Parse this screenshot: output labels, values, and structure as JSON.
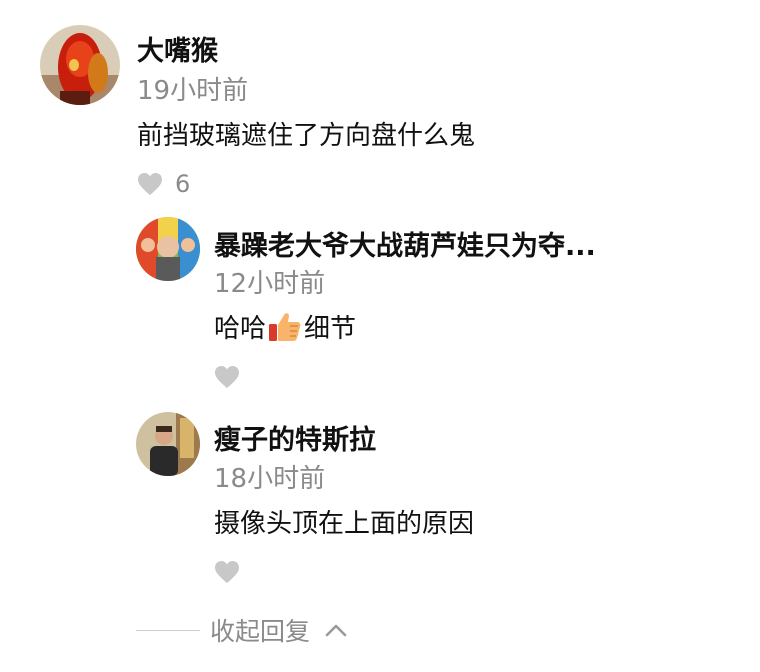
{
  "comment": {
    "author": "大嘴猴",
    "time": "19小时前",
    "text": "前挡玻璃遮住了方向盘什么鬼",
    "likes": "6"
  },
  "replies": [
    {
      "author": "暴躁老大爷大战葫芦娃只为夺...",
      "time": "12小时前",
      "text_before": "哈哈",
      "emoji": "thumbs-up-icon",
      "text_after": "细节"
    },
    {
      "author": "瘦子的特斯拉",
      "time": "18小时前",
      "text": "摄像头顶在上面的原因"
    }
  ],
  "collapse_label": "收起回复",
  "colors": {
    "text": "#111111",
    "muted": "#8a8a8a",
    "heart": "#c8c8c8"
  }
}
